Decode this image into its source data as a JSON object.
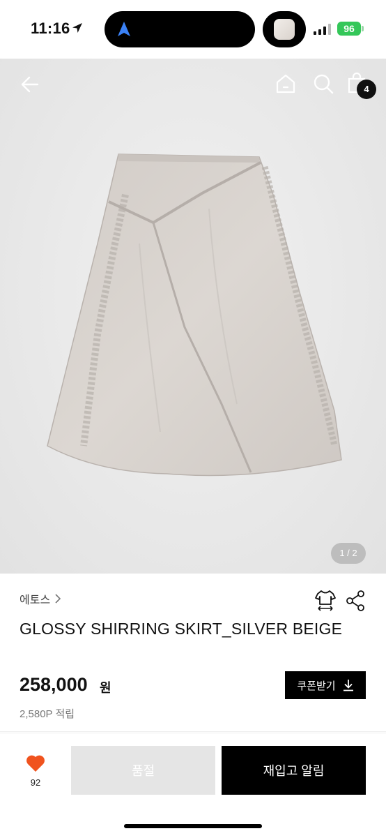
{
  "status_bar": {
    "time": "11:16",
    "battery": "96"
  },
  "header": {
    "cart_count": "4"
  },
  "gallery": {
    "pager": "1 / 2"
  },
  "product": {
    "brand": "에토스",
    "title": "GLOSSY SHIRRING SKIRT_SILVER BEIGE",
    "price": "258,000",
    "price_unit": "원",
    "coupon_label": "쿠폰받기",
    "points": "2,580P 적립"
  },
  "actions": {
    "like_count": "92",
    "soldout_label": "품절",
    "restock_label": "재입고 알림"
  },
  "colors": {
    "like": "#f0531e",
    "primary": "#000000",
    "disabled": "#e5e5e5"
  }
}
